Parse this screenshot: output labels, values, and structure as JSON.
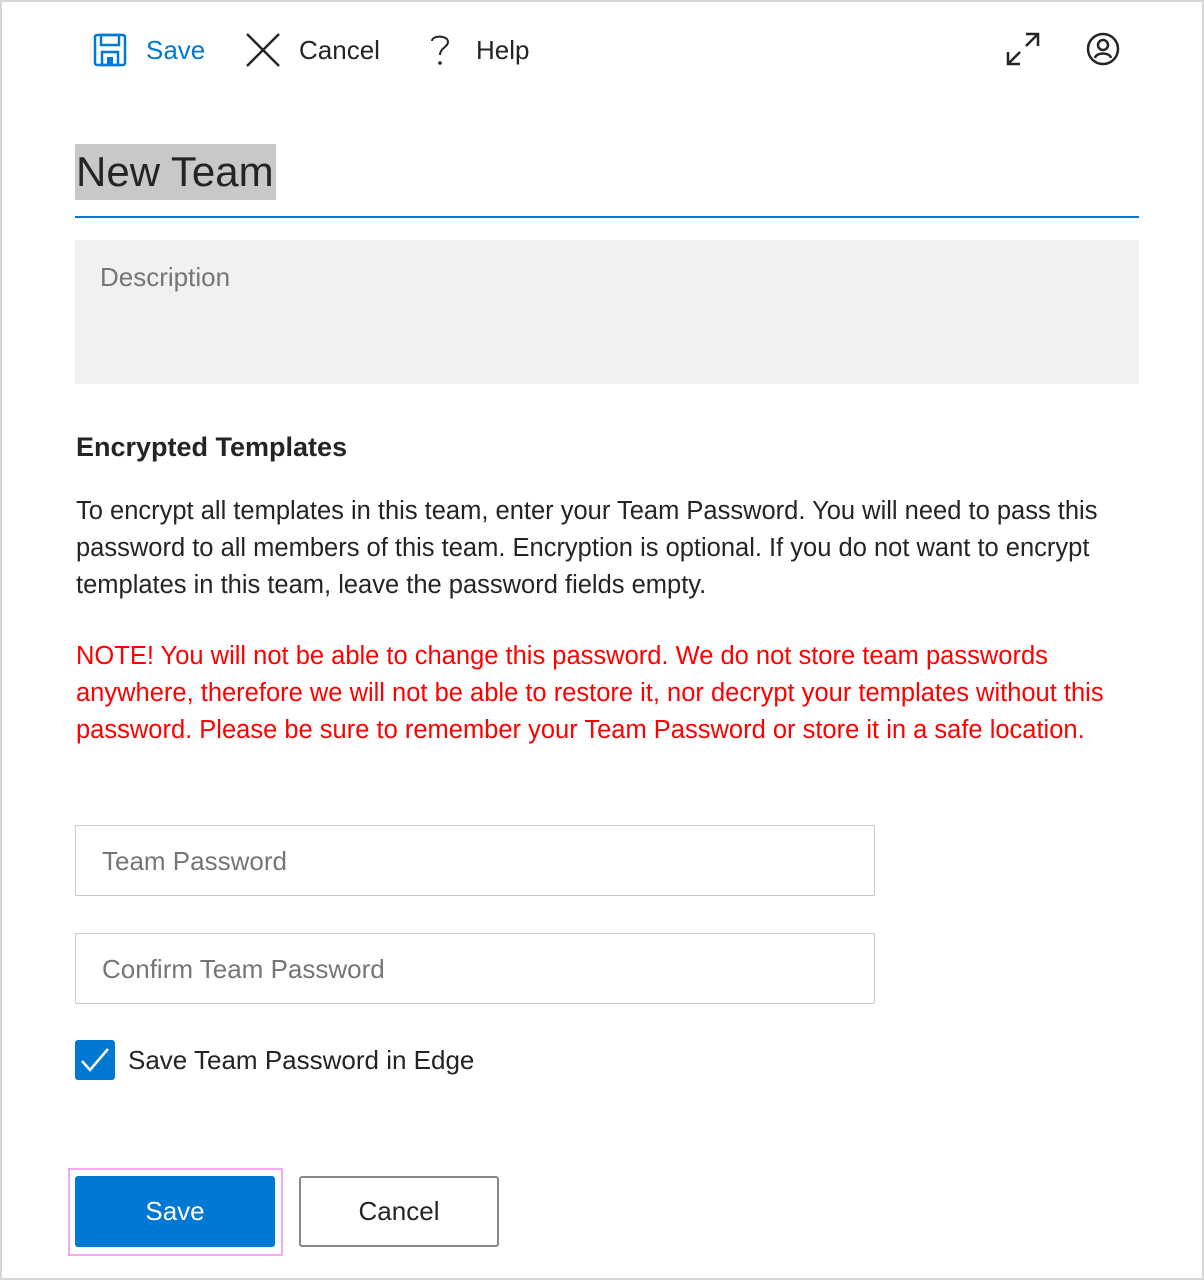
{
  "toolbar": {
    "save_label": "Save",
    "cancel_label": "Cancel",
    "help_label": "Help",
    "icons": {
      "save": "floppy-disk-icon",
      "cancel": "close-x-icon",
      "help": "question-mark-icon",
      "expand": "expand-arrows-icon",
      "account": "user-account-icon"
    }
  },
  "form": {
    "team_name": "New Team",
    "description_placeholder": "Description",
    "section_title": "Encrypted Templates",
    "info_text": "To encrypt all templates in this team, enter your Team Password. You will need to pass this password to all members of this team. Encryption is optional. If you do not want to encrypt templates in this team, leave the password fields empty.",
    "note_text": "NOTE! You will not be able to change this password. We do not store team passwords anywhere, therefore we will not be able to restore it, nor decrypt your templates without this password. Please be sure to remember your Team Password or store it in a safe location.",
    "password_placeholder": "Team Password",
    "password_value": "",
    "confirm_password_placeholder": "Confirm Team Password",
    "confirm_password_value": "",
    "save_in_edge_label": "Save Team Password in Edge",
    "save_in_edge_checked": true
  },
  "footer": {
    "save_label": "Save",
    "cancel_label": "Cancel"
  },
  "colors": {
    "accent": "#0078d4",
    "warning_text": "#ff0000",
    "focus_ring": "#f5a8f5",
    "selection_highlight": "#c8c8c8",
    "description_bg": "#f1f1f1"
  }
}
